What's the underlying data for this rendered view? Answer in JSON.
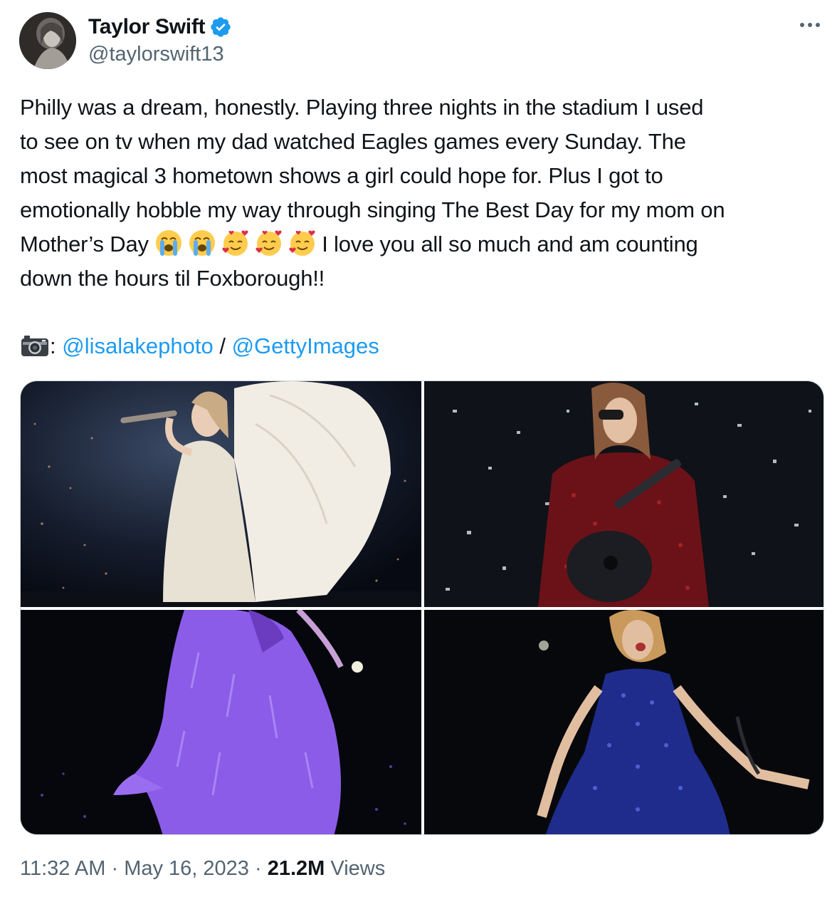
{
  "author": {
    "display_name": "Taylor Swift",
    "handle": "@taylorswift13",
    "verified": true,
    "avatar_icon": "profile-photo"
  },
  "menu_icon": "more-horizontal-icon",
  "tweet": {
    "lines": [
      "Philly was a dream, honestly. Playing three nights in the stadium I used",
      "to see on tv when my dad watched Eagles games every Sunday. The",
      "most magical 3 hometown shows a girl could hope for. Plus I got to",
      "emotionally hobble my way through singing The Best Day for my mom on"
    ],
    "line5_start": "Mother’s Day",
    "emojis": [
      "😭",
      "😭",
      "🥰",
      "🥰",
      "🥰"
    ],
    "line5_end": "I love you all so much and am counting",
    "line6": "down the hours til Foxborough!!"
  },
  "credit": {
    "icon": "camera-icon",
    "prefix": ":",
    "link1": "@lisalakephoto",
    "separator": "/",
    "link2": "@GettyImages"
  },
  "media": {
    "photos": [
      "singer-in-white-gown-photo",
      "singer-red-sequins-guitar-photo",
      "singer-purple-fur-coat-photo",
      "singer-blue-sequin-dress-photo"
    ]
  },
  "meta": {
    "time": "11:32 AM",
    "dot1": "·",
    "date": "May 16, 2023",
    "dot2": "·",
    "views_count": "21.2M",
    "views_label": "Views"
  },
  "colors": {
    "link": "#1d9bf0",
    "secondary_text": "#536471",
    "primary_text": "#0f1419"
  }
}
